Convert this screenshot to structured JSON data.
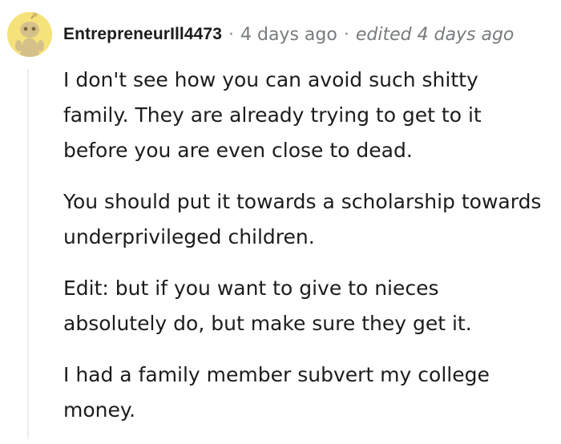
{
  "comment": {
    "author": "EntrepreneurIll4473",
    "separator": "·",
    "timestamp": "4 days ago",
    "edited": "edited 4 days ago",
    "avatar_icon": "snoo-avatar-icon",
    "paragraphs": [
      "I don't see how you can avoid such shitty family. They are already trying to get to it before you are even close to dead.",
      "You should put it towards a scholarship towards underprivileged children.",
      "Edit: but if you want to give to nieces absolutely do, but make sure they get it.",
      "I had a family member subvert my college money."
    ]
  },
  "colors": {
    "avatar_bg": "#f5e27a",
    "text": "#1c1c1c",
    "meta": "#787c7e",
    "thread_line": "#ededed"
  }
}
